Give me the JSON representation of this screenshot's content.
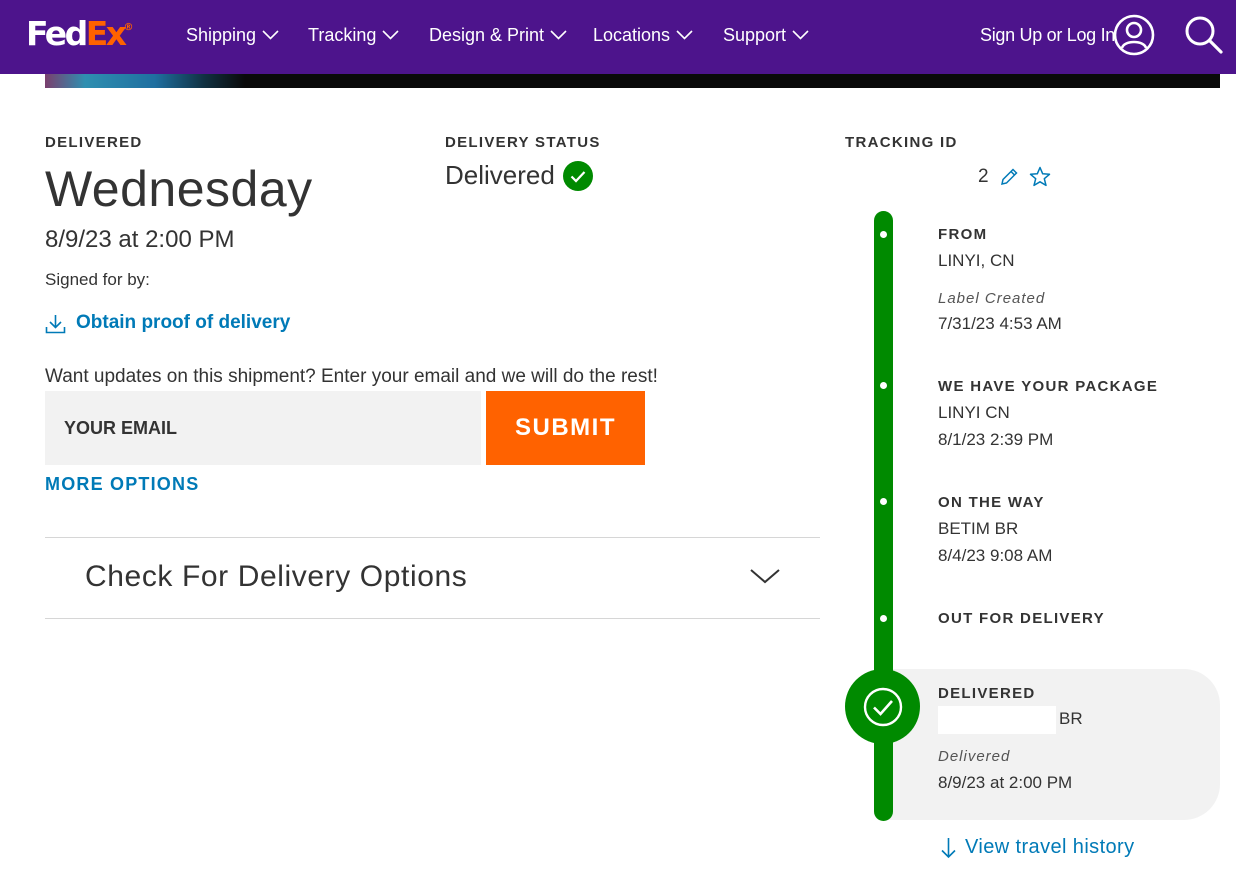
{
  "header": {
    "logo": {
      "fed": "Fed",
      "ex": "Ex",
      "mark": "®"
    },
    "nav": [
      "Shipping",
      "Tracking",
      "Design & Print",
      "Locations",
      "Support"
    ],
    "sign_in": "Sign Up or Log In",
    "icons": {
      "user": "user-icon",
      "search": "search-icon",
      "chevron": "chevron-down-icon"
    }
  },
  "delivery": {
    "label": "DELIVERED",
    "day": "Wednesday",
    "datetime": "8/9/23 at 2:00 PM",
    "signed_for": "Signed for by:",
    "proof_link": "Obtain proof of delivery"
  },
  "status": {
    "label": "DELIVERY STATUS",
    "value": "Delivered"
  },
  "updates": {
    "prompt": "Want updates on this shipment? Enter your email and we will do the rest!",
    "email_placeholder": "YOUR EMAIL",
    "submit_label": "SUBMIT",
    "more_options": "MORE OPTIONS"
  },
  "delivery_options": {
    "title": "Check For Delivery Options"
  },
  "tracking": {
    "label": "TRACKING ID",
    "id": "2",
    "events": [
      {
        "title": "FROM",
        "location": "LINYI, CN",
        "sub": "Label Created",
        "time": "7/31/23 4:53 AM"
      },
      {
        "title": "WE HAVE YOUR PACKAGE",
        "location": "LINYI CN",
        "time": "8/1/23 2:39 PM"
      },
      {
        "title": "ON THE WAY",
        "location": "BETIM BR",
        "time": "8/4/23 9:08 AM"
      },
      {
        "title": "OUT FOR DELIVERY"
      },
      {
        "title": "DELIVERED",
        "location": "BR",
        "sub": "Delivered",
        "time": "8/9/23 at 2:00 PM"
      }
    ],
    "view_history": "View travel history"
  },
  "colors": {
    "brand_purple": "#4d148c",
    "brand_orange": "#ff6200",
    "status_green": "#008a00",
    "link_blue": "#007ab7"
  }
}
